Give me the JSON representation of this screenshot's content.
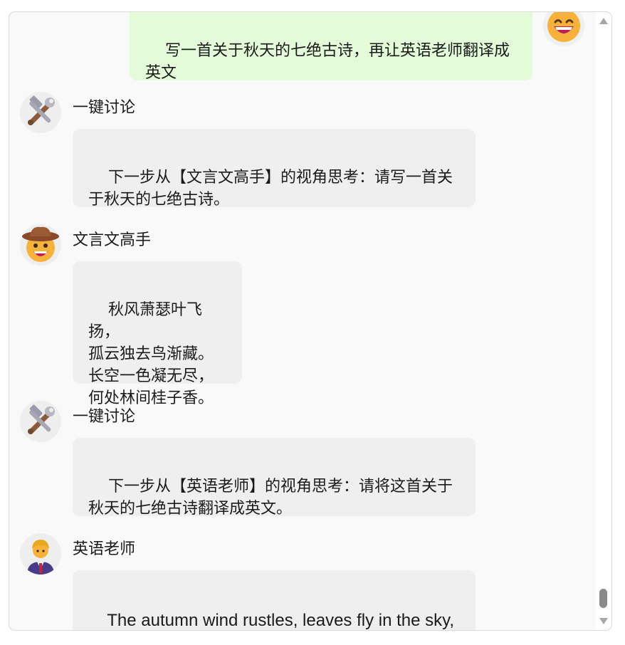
{
  "messages": [
    {
      "role": "user",
      "text": "写一首关于秋天的七绝古诗，再让英语老师翻译成英文",
      "avatar_icon": "grinning-face-icon"
    },
    {
      "role": "bot",
      "sender": "一键讨论",
      "avatar_icon": "hammer-and-wrench-icon",
      "text": "下一步从【文言文高手】的视角思考：请写一首关于秋天的七绝古诗。"
    },
    {
      "role": "bot",
      "sender": "文言文高手",
      "avatar_icon": "cowboy-hat-face-icon",
      "text": "秋风萧瑟叶飞扬，\n孤云独去鸟渐藏。\n长空一色凝无尽，\n何处林间桂子香。"
    },
    {
      "role": "bot",
      "sender": "一键讨论",
      "avatar_icon": "hammer-and-wrench-icon",
      "text": "下一步从【英语老师】的视角思考：请将这首关于秋天的七绝古诗翻译成英文。"
    },
    {
      "role": "bot",
      "sender": "英语老师",
      "avatar_icon": "teacher-person-icon",
      "text": "The autumn wind rustles, leaves fly in the sky,\nLonely clouds drift away, birds hide in the thi"
    }
  ],
  "scrollbar": {
    "thumb_color": "#8a8a8a",
    "arrow_color": "#a6a6a6"
  },
  "colors": {
    "user_bubble": "#e3fbd9",
    "bot_bubble": "#efefef",
    "background": "#f9f9f9"
  }
}
